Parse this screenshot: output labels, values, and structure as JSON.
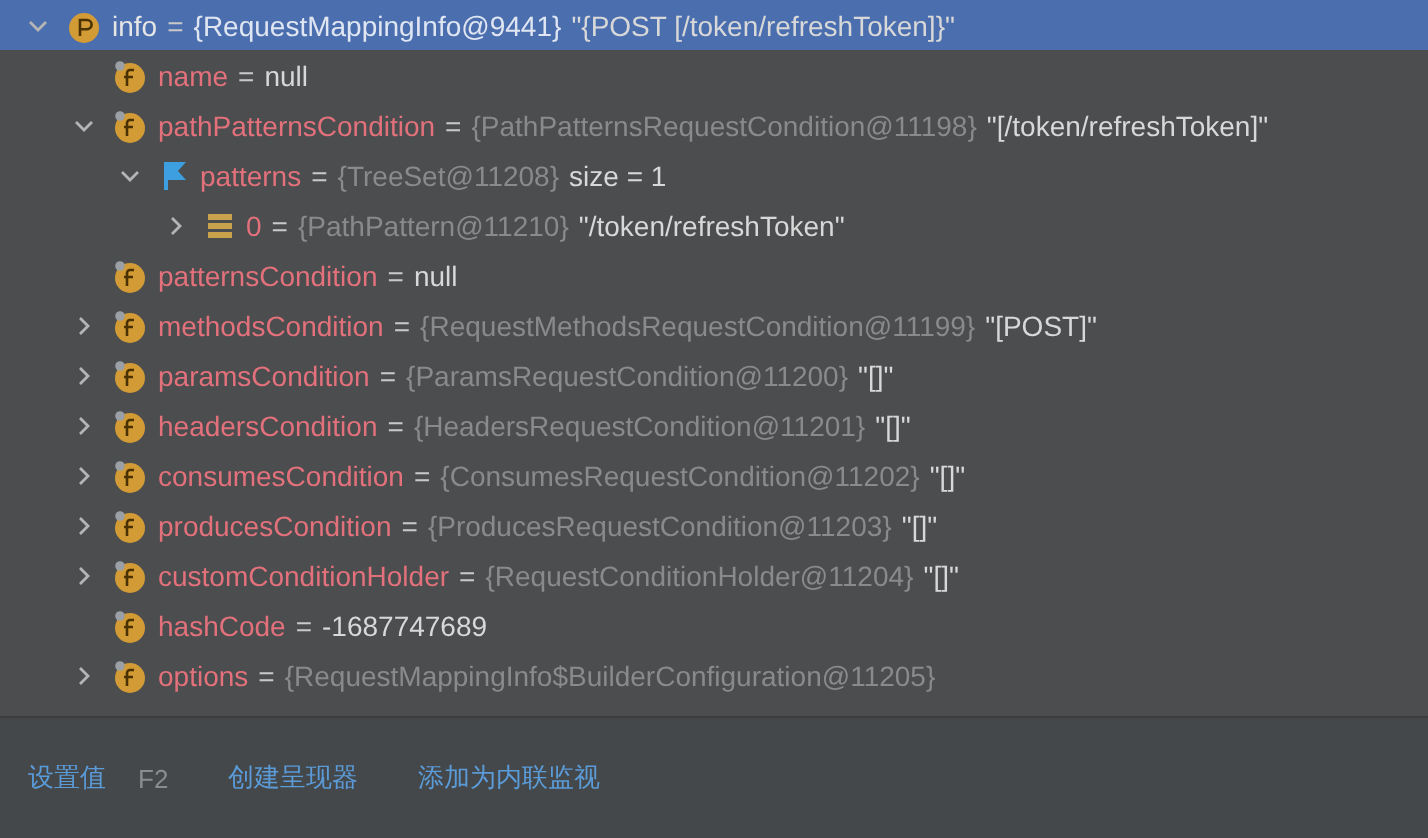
{
  "tree": [
    {
      "name": "info",
      "kind": "property",
      "selected": true,
      "expanded": true,
      "sep": "=",
      "type": "{RequestMappingInfo@9441}",
      "value": "\"{POST [/token/refreshToken]}\"",
      "children": [
        {
          "name": "name",
          "kind": "field",
          "selected": false,
          "sep": "=",
          "value": "null"
        },
        {
          "name": "pathPatternsCondition",
          "kind": "field",
          "selected": false,
          "expanded": true,
          "sep": "=",
          "type": "{PathPatternsRequestCondition@11198}",
          "value": "\"[/token/refreshToken]\"",
          "children": [
            {
              "name": "patterns",
              "kind": "flag",
              "selected": false,
              "expanded": true,
              "sep": "=",
              "type": "{TreeSet@11208}",
              "value": "size = 1",
              "children": [
                {
                  "name": "0",
                  "kind": "element",
                  "selected": false,
                  "expanded": false,
                  "sep": "=",
                  "type": "{PathPattern@11210}",
                  "value": "\"/token/refreshToken\""
                }
              ]
            }
          ]
        },
        {
          "name": "patternsCondition",
          "kind": "field",
          "selected": false,
          "sep": "=",
          "value": "null"
        },
        {
          "name": "methodsCondition",
          "kind": "field",
          "selected": false,
          "expanded": false,
          "sep": "=",
          "type": "{RequestMethodsRequestCondition@11199}",
          "value": "\"[POST]\""
        },
        {
          "name": "paramsCondition",
          "kind": "field",
          "selected": false,
          "expanded": false,
          "sep": "=",
          "type": "{ParamsRequestCondition@11200}",
          "value": "\"[]\""
        },
        {
          "name": "headersCondition",
          "kind": "field",
          "selected": false,
          "expanded": false,
          "sep": "=",
          "type": "{HeadersRequestCondition@11201}",
          "value": "\"[]\""
        },
        {
          "name": "consumesCondition",
          "kind": "field",
          "selected": false,
          "expanded": false,
          "sep": "=",
          "type": "{ConsumesRequestCondition@11202}",
          "value": "\"[]\""
        },
        {
          "name": "producesCondition",
          "kind": "field",
          "selected": false,
          "expanded": false,
          "sep": "=",
          "type": "{ProducesRequestCondition@11203}",
          "value": "\"[]\""
        },
        {
          "name": "customConditionHolder",
          "kind": "field",
          "selected": false,
          "expanded": false,
          "sep": "=",
          "type": "{RequestConditionHolder@11204}",
          "value": "\"[]\""
        },
        {
          "name": "hashCode",
          "kind": "field",
          "selected": false,
          "sep": "=",
          "value": "-1687747689"
        },
        {
          "name": "options",
          "kind": "field",
          "selected": false,
          "expanded": false,
          "sep": "=",
          "type": "{RequestMappingInfo$BuilderConfiguration@11205}"
        }
      ]
    }
  ],
  "actions": [
    {
      "label": "设置值",
      "shortcut": "F2"
    },
    {
      "label": "创建呈现器"
    },
    {
      "label": "添加为内联监视"
    }
  ]
}
